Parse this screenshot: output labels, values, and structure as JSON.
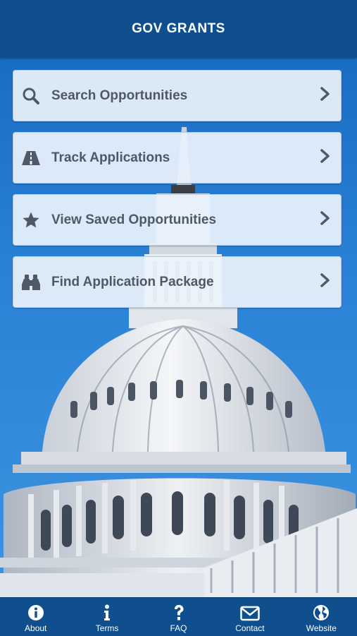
{
  "header": {
    "title": "GOV GRANTS"
  },
  "menu": {
    "items": [
      {
        "label": "Search Opportunities",
        "icon": "search-icon"
      },
      {
        "label": "Track Applications",
        "icon": "road-icon"
      },
      {
        "label": "View Saved Opportunities",
        "icon": "star-icon"
      },
      {
        "label": "Find Application Package",
        "icon": "binoculars-icon"
      }
    ]
  },
  "tabs": [
    {
      "label": "About",
      "icon": "info-circle-icon"
    },
    {
      "label": "Terms",
      "icon": "info-icon"
    },
    {
      "label": "FAQ",
      "icon": "question-icon"
    },
    {
      "label": "Contact",
      "icon": "envelope-icon"
    },
    {
      "label": "Website",
      "icon": "globe-icon"
    }
  ],
  "colors": {
    "header": "#0f4f8e",
    "background": "#1f6fc0",
    "menu_text": "#4e5866"
  }
}
